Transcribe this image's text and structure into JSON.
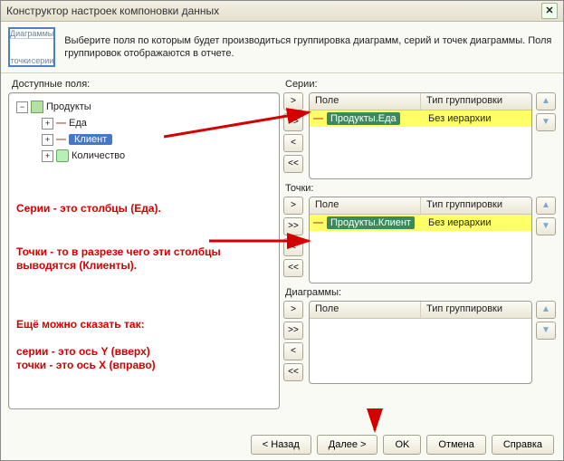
{
  "window": {
    "title": "Конструктор настроек компоновки данных"
  },
  "toolbar": {
    "icon_top": "Диаграммы",
    "icon_left": "точки",
    "icon_right": "серии",
    "description": "Выберите поля по которым будет производиться группировка диаграмм, серий и точек диаграммы. Поля группировок отображаются в отчете."
  },
  "left_panel": {
    "label": "Доступные поля:",
    "tree": {
      "root": "Продукты",
      "children": [
        {
          "name": "Еда"
        },
        {
          "name": "Клиент",
          "selected": true
        },
        {
          "name": "Количество"
        }
      ]
    }
  },
  "sections": {
    "series": {
      "label": "Серии:",
      "col_field": "Поле",
      "col_group": "Тип группировки",
      "row_field": "Продукты.Еда",
      "row_group": "Без иерархии"
    },
    "points": {
      "label": "Точки:",
      "col_field": "Поле",
      "col_group": "Тип группировки",
      "row_field": "Продукты.Клиент",
      "row_group": "Без иерархии"
    },
    "diagrams": {
      "label": "Диаграммы:",
      "col_field": "Поле",
      "col_group": "Тип группировки"
    }
  },
  "annot": {
    "a1": "Серии - это столбцы (Еда).",
    "a2": "Точки - то в разрезе чего эти столбцы выводятся (Клиенты).",
    "a3": "Ещё можно сказать так:",
    "a4": "серии - это ось Y (вверх)\nточки - это ось X (вправо)"
  },
  "buttons": {
    "back": "< Назад",
    "next": "Далее >",
    "ok": "OK",
    "cancel": "Отмена",
    "help": "Справка",
    "add": ">",
    "addall": ">>",
    "rem": "<",
    "remall": "<<",
    "up": "▲",
    "down": "▼"
  }
}
